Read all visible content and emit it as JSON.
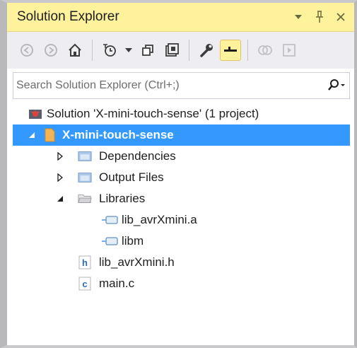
{
  "panel": {
    "title": "Solution Explorer"
  },
  "search": {
    "placeholder": "Search Solution Explorer (Ctrl+;)"
  },
  "tree": {
    "solution": "Solution 'X-mini-touch-sense' (1 project)",
    "project": "X-mini-touch-sense",
    "dependencies": "Dependencies",
    "output_files": "Output Files",
    "libraries": "Libraries",
    "lib_avr": "lib_avrXmini.a",
    "libm": "libm",
    "header_file": "lib_avrXmini.h",
    "main_file": "main.c"
  },
  "colors": {
    "title_bg": "#fff29d",
    "selected_bg": "#3399ff",
    "toolbar_bg": "#eeeef2"
  }
}
